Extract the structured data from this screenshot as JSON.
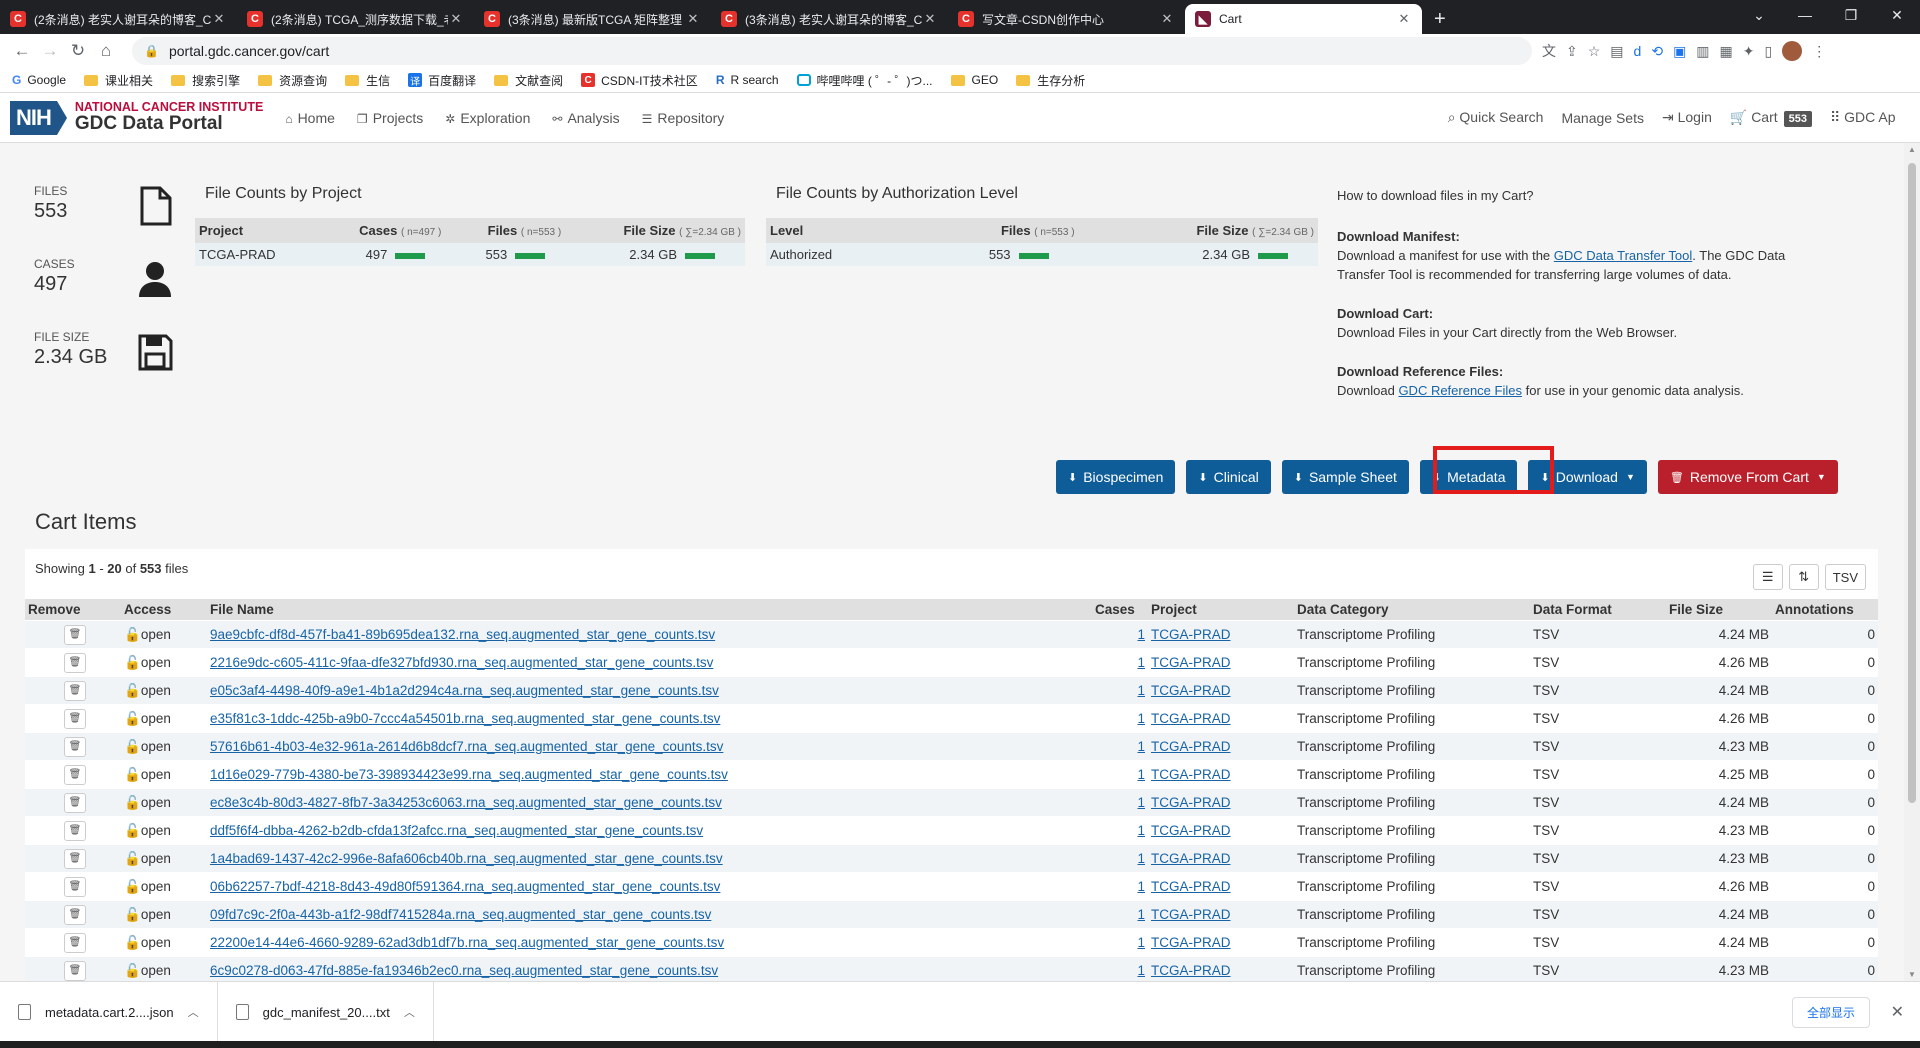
{
  "browser": {
    "tabs": [
      {
        "title": "(2条消息) 老实人谢耳朵的博客_C"
      },
      {
        "title": "(2条消息) TCGA_测序数据下载_老"
      },
      {
        "title": "(3条消息) 最新版TCGA 矩阵整理"
      },
      {
        "title": "(3条消息) 老实人谢耳朵的博客_C"
      },
      {
        "title": "写文章-CSDN创作中心"
      },
      {
        "title": "Cart"
      }
    ],
    "url": "portal.gdc.cancer.gov/cart",
    "bookmarks": [
      "Google",
      "课业相关",
      "搜索引擎",
      "资源查询",
      "生信",
      "百度翻译",
      "文献查阅",
      "CSDN-IT技术社区",
      "R search",
      "哔哩哔哩 ( ゜- ゜)つ...",
      "GEO",
      "生存分析"
    ]
  },
  "header": {
    "nih": "NIH",
    "nci": "NATIONAL CANCER INSTITUTE",
    "portal": "GDC Data Portal",
    "nav": [
      "Home",
      "Projects",
      "Exploration",
      "Analysis",
      "Repository"
    ],
    "quick_search": "Quick Search",
    "manage_sets": "Manage Sets",
    "login": "Login",
    "cart": "Cart",
    "cart_count": "553",
    "apps": "GDC Ap"
  },
  "summary": {
    "files_label": "FILES",
    "files_value": "553",
    "cases_label": "CASES",
    "cases_value": "497",
    "size_label": "FILE SIZE",
    "size_value": "2.34 GB"
  },
  "by_project": {
    "title": "File Counts by Project",
    "headers": {
      "project": "Project",
      "cases": "Cases",
      "cases_n": "( n=497 )",
      "files": "Files",
      "files_n": "( n=553 )",
      "size": "File Size",
      "size_n": "( ∑=2.34 GB )"
    },
    "row": {
      "project": "TCGA-PRAD",
      "cases": "497",
      "files": "553",
      "size": "2.34 GB"
    }
  },
  "by_auth": {
    "title": "File Counts by Authorization Level",
    "headers": {
      "level": "Level",
      "files": "Files",
      "files_n": "( n=553 )",
      "size": "File Size",
      "size_n": "( ∑=2.34 GB )"
    },
    "row": {
      "level": "Authorized",
      "files": "553",
      "size": "2.34 GB"
    }
  },
  "help": {
    "question": "How to download files in my Cart?",
    "manifest_h": "Download Manifest:",
    "manifest_t1": "Download a manifest for use with the ",
    "manifest_link": "GDC Data Transfer Tool",
    "manifest_t2": ". The GDC Data Transfer Tool is recommended for transferring large volumes of data.",
    "cart_h": "Download Cart:",
    "cart_t": "Download Files in your Cart directly from the Web Browser.",
    "ref_h": "Download Reference Files:",
    "ref_t1": "Download ",
    "ref_link": "GDC Reference Files",
    "ref_t2": " for use in your genomic data analysis."
  },
  "actions": {
    "biospecimen": "Biospecimen",
    "clinical": "Clinical",
    "sample_sheet": "Sample Sheet",
    "metadata": "Metadata",
    "download": "Download",
    "remove": "Remove From Cart"
  },
  "cart": {
    "title": "Cart Items",
    "showing_prefix": "Showing ",
    "range_start": "1",
    "range_sep": " - ",
    "range_end": "20",
    "of": " of ",
    "total": "553",
    "files_word": " files",
    "tsv_button": "TSV",
    "columns": [
      "Remove",
      "Access",
      "File Name",
      "Cases",
      "Project",
      "Data Category",
      "Data Format",
      "File Size",
      "Annotations"
    ],
    "rows": [
      {
        "access": "open",
        "name": "9ae9cbfc-df8d-457f-ba41-89b695dea132.rna_seq.augmented_star_gene_counts.tsv",
        "cases": "1",
        "project": "TCGA-PRAD",
        "category": "Transcriptome Profiling",
        "format": "TSV",
        "size": "4.24 MB",
        "ann": "0"
      },
      {
        "access": "open",
        "name": "2216e9dc-c605-411c-9faa-dfe327bfd930.rna_seq.augmented_star_gene_counts.tsv",
        "cases": "1",
        "project": "TCGA-PRAD",
        "category": "Transcriptome Profiling",
        "format": "TSV",
        "size": "4.26 MB",
        "ann": "0"
      },
      {
        "access": "open",
        "name": "e05c3af4-4498-40f9-a9e1-4b1a2d294c4a.rna_seq.augmented_star_gene_counts.tsv",
        "cases": "1",
        "project": "TCGA-PRAD",
        "category": "Transcriptome Profiling",
        "format": "TSV",
        "size": "4.24 MB",
        "ann": "0"
      },
      {
        "access": "open",
        "name": "e35f81c3-1ddc-425b-a9b0-7ccc4a54501b.rna_seq.augmented_star_gene_counts.tsv",
        "cases": "1",
        "project": "TCGA-PRAD",
        "category": "Transcriptome Profiling",
        "format": "TSV",
        "size": "4.26 MB",
        "ann": "0"
      },
      {
        "access": "open",
        "name": "57616b61-4b03-4e32-961a-2614d6b8dcf7.rna_seq.augmented_star_gene_counts.tsv",
        "cases": "1",
        "project": "TCGA-PRAD",
        "category": "Transcriptome Profiling",
        "format": "TSV",
        "size": "4.23 MB",
        "ann": "0"
      },
      {
        "access": "open",
        "name": "1d16e029-779b-4380-be73-398934423e99.rna_seq.augmented_star_gene_counts.tsv",
        "cases": "1",
        "project": "TCGA-PRAD",
        "category": "Transcriptome Profiling",
        "format": "TSV",
        "size": "4.25 MB",
        "ann": "0"
      },
      {
        "access": "open",
        "name": "ec8e3c4b-80d3-4827-8fb7-3a34253c6063.rna_seq.augmented_star_gene_counts.tsv",
        "cases": "1",
        "project": "TCGA-PRAD",
        "category": "Transcriptome Profiling",
        "format": "TSV",
        "size": "4.24 MB",
        "ann": "0"
      },
      {
        "access": "open",
        "name": "ddf5f6f4-dbba-4262-b2db-cfda13f2afcc.rna_seq.augmented_star_gene_counts.tsv",
        "cases": "1",
        "project": "TCGA-PRAD",
        "category": "Transcriptome Profiling",
        "format": "TSV",
        "size": "4.23 MB",
        "ann": "0"
      },
      {
        "access": "open",
        "name": "1a4bad69-1437-42c2-996e-8afa606cb40b.rna_seq.augmented_star_gene_counts.tsv",
        "cases": "1",
        "project": "TCGA-PRAD",
        "category": "Transcriptome Profiling",
        "format": "TSV",
        "size": "4.23 MB",
        "ann": "0"
      },
      {
        "access": "open",
        "name": "06b62257-7bdf-4218-8d43-49d80f591364.rna_seq.augmented_star_gene_counts.tsv",
        "cases": "1",
        "project": "TCGA-PRAD",
        "category": "Transcriptome Profiling",
        "format": "TSV",
        "size": "4.26 MB",
        "ann": "0"
      },
      {
        "access": "open",
        "name": "09fd7c9c-2f0a-443b-a1f2-98df7415284a.rna_seq.augmented_star_gene_counts.tsv",
        "cases": "1",
        "project": "TCGA-PRAD",
        "category": "Transcriptome Profiling",
        "format": "TSV",
        "size": "4.24 MB",
        "ann": "0"
      },
      {
        "access": "open",
        "name": "22200e14-44e6-4660-9289-62ad3db1df7b.rna_seq.augmented_star_gene_counts.tsv",
        "cases": "1",
        "project": "TCGA-PRAD",
        "category": "Transcriptome Profiling",
        "format": "TSV",
        "size": "4.24 MB",
        "ann": "0"
      },
      {
        "access": "open",
        "name": "6c9c0278-d063-47fd-885e-fa19346b2ec0.rna_seq.augmented_star_gene_counts.tsv",
        "cases": "1",
        "project": "TCGA-PRAD",
        "category": "Transcriptome Profiling",
        "format": "TSV",
        "size": "4.23 MB",
        "ann": "0"
      }
    ]
  },
  "downloads": [
    {
      "name": "metadata.cart.2....json"
    },
    {
      "name": "gdc_manifest_20....txt"
    }
  ],
  "show_all": "全部显示",
  "colors": {
    "primary": "#0e5d99",
    "danger": "#b9202b",
    "highlight": "#e41b1b",
    "bar": "#1e9a4a"
  }
}
